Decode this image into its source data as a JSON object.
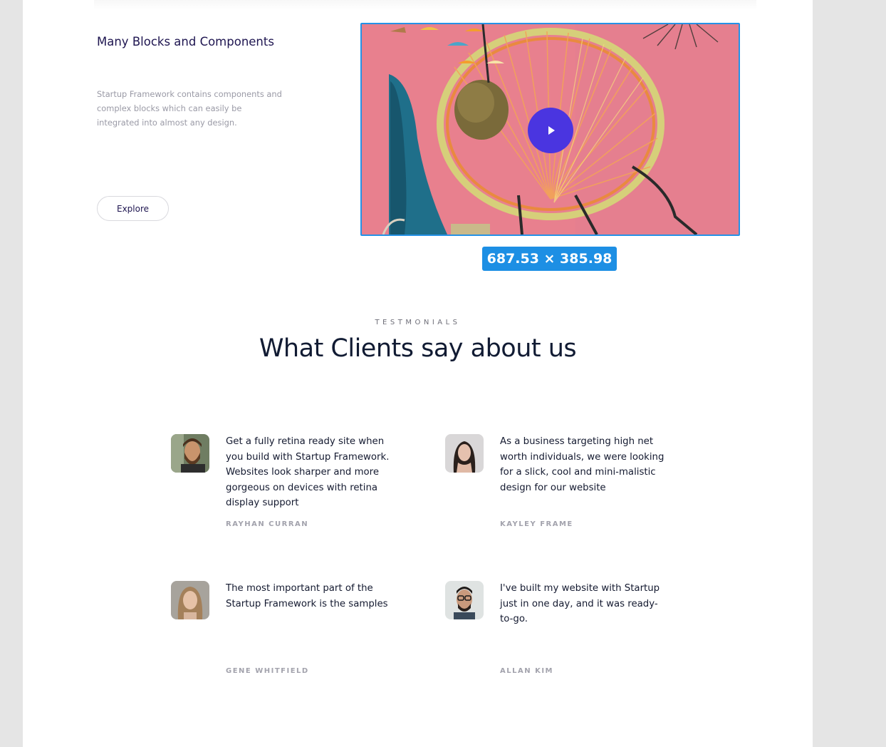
{
  "feature": {
    "title": "Many Blocks and Components",
    "description": "Startup Framework contains components and complex blocks which can easily be integrated into almost any design.",
    "button_label": "Explore"
  },
  "video": {
    "play_icon": "play-icon",
    "size_badge": "687.53 × 385.98",
    "selection_color": "#2592e6",
    "play_color": "#4a35e0"
  },
  "testimonials_section": {
    "eyebrow": "TESTMONIALS",
    "title": "What Clients say about us",
    "items": [
      {
        "quote": "Get a fully retina ready site when you build with Startup Framework. Websites look sharper and more gorgeous on devices with retina display support",
        "author": "RAYHAN CURRAN",
        "avatar": "avatar-man-beard"
      },
      {
        "quote": "As a business targeting high net worth individuals, we were looking for a slick, cool and mini-malistic design for our website",
        "author": "KAYLEY FRAME",
        "avatar": "avatar-woman-dark-hair"
      },
      {
        "quote": "The most important part of the Startup Framework is the samples",
        "author": "GENE WHITFIELD",
        "avatar": "avatar-woman-blonde"
      },
      {
        "quote": "I've built my website with Startup just in one day, and it was ready-to-go.",
        "author": "ALLAN KIM",
        "avatar": "avatar-man-glasses"
      }
    ]
  },
  "colors": {
    "page_background": "#e5e5e5",
    "content_background": "#ffffff",
    "heading": "#111b33",
    "accent_text": "#1e1550"
  }
}
